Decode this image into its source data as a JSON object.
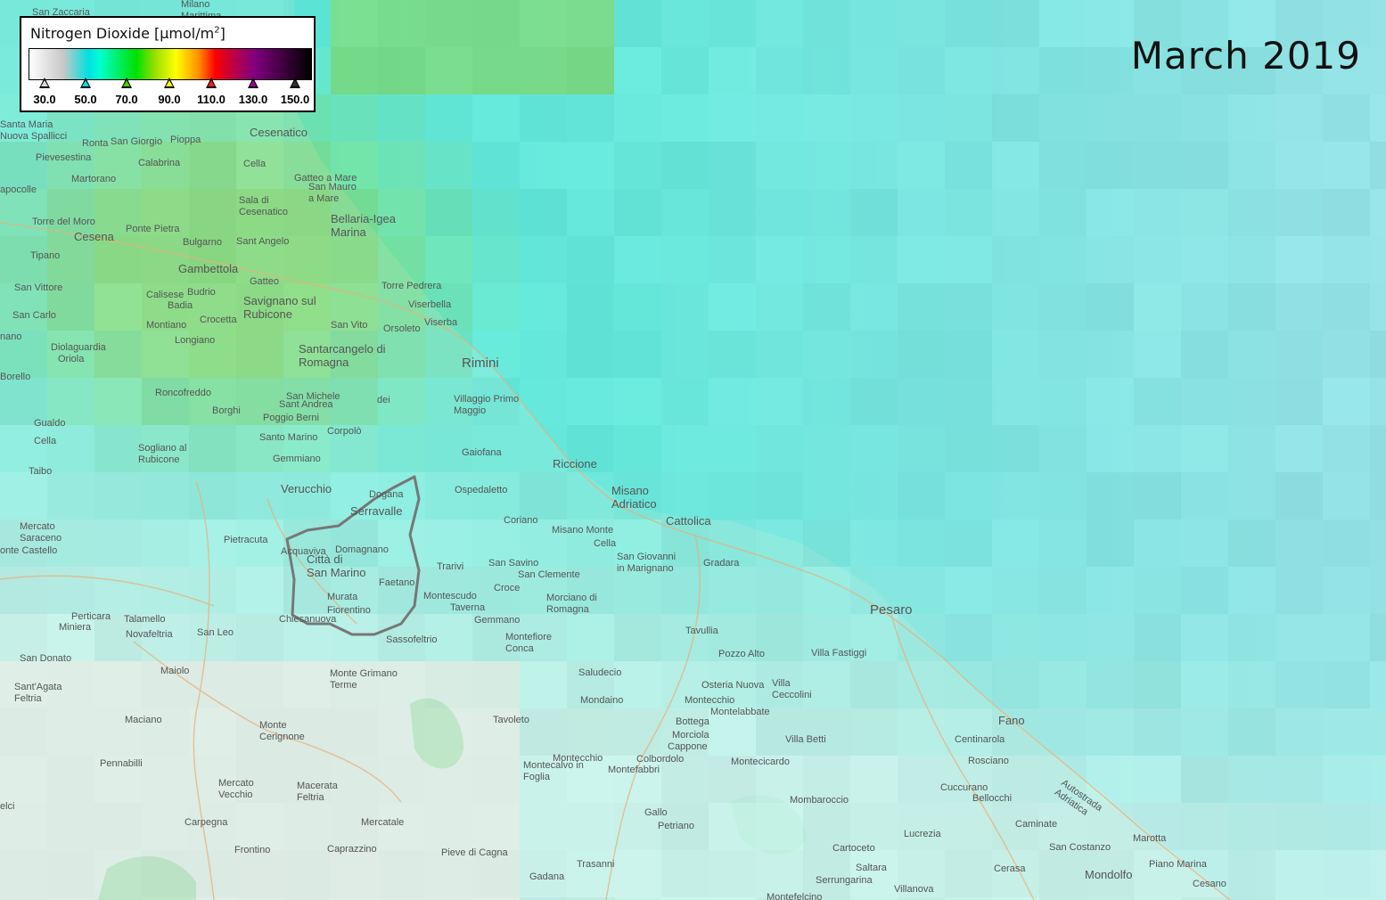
{
  "legend": {
    "title": "Nitrogen Dioxide [µmol/m",
    "title_sup": "2",
    "title_end": "]",
    "ticks": [
      {
        "label": "30.0",
        "color": "#d8d8d8"
      },
      {
        "label": "50.0",
        "color": "#00e0e0"
      },
      {
        "label": "70.0",
        "color": "#40d000"
      },
      {
        "label": "90.0",
        "color": "#ffff00"
      },
      {
        "label": "110.0",
        "color": "#ff2020"
      },
      {
        "label": "130.0",
        "color": "#a000a0"
      },
      {
        "label": "150.0",
        "color": "#303030"
      }
    ]
  },
  "date_label": "March 2019",
  "colors": {
    "sea": "#a9e2ea",
    "high_no2": "#7ad87a",
    "mid_no2": "#5de6d6",
    "low_no2": "#c7efe8",
    "land": "#eeeae3",
    "country_border": "#777777"
  },
  "places": [
    {
      "name": "Milano Marittima",
      "size": "sm"
    },
    {
      "name": "San Zaccaria",
      "size": "sm"
    },
    {
      "name": "Cesenatico",
      "size": "md"
    },
    {
      "name": "Santa Maria Nuova Spallicci",
      "size": "sm"
    },
    {
      "name": "Ronta",
      "size": "sm"
    },
    {
      "name": "San Giorgio",
      "size": "sm"
    },
    {
      "name": "Pioppa",
      "size": "sm"
    },
    {
      "name": "Pievesestina",
      "size": "sm"
    },
    {
      "name": "Calabrina",
      "size": "sm"
    },
    {
      "name": "Cella",
      "size": "sm"
    },
    {
      "name": "Martorano",
      "size": "sm"
    },
    {
      "name": "Gatteo a Mare",
      "size": "sm"
    },
    {
      "name": "San Mauro a Mare",
      "size": "sm"
    },
    {
      "name": "apocolle",
      "size": "sm"
    },
    {
      "name": "Sala di Cesenatico",
      "size": "sm"
    },
    {
      "name": "Torre del Moro",
      "size": "sm"
    },
    {
      "name": "Bellaria-Igea Marina",
      "size": "md"
    },
    {
      "name": "Cesena",
      "size": "md"
    },
    {
      "name": "Ponte Pietra",
      "size": "sm"
    },
    {
      "name": "Bulgarno",
      "size": "sm"
    },
    {
      "name": "Sant Angelo",
      "size": "sm"
    },
    {
      "name": "Tipano",
      "size": "sm"
    },
    {
      "name": "Gambettola",
      "size": "md"
    },
    {
      "name": "Gatteo",
      "size": "sm"
    },
    {
      "name": "Torre Pedrera",
      "size": "sm"
    },
    {
      "name": "San Vittore",
      "size": "sm"
    },
    {
      "name": "Calisese",
      "size": "sm"
    },
    {
      "name": "Budrio",
      "size": "sm"
    },
    {
      "name": "Badia",
      "size": "sm"
    },
    {
      "name": "Savignano sul Rubicone",
      "size": "md"
    },
    {
      "name": "Viserbella",
      "size": "sm"
    },
    {
      "name": "San Carlo",
      "size": "sm"
    },
    {
      "name": "Crocetta",
      "size": "sm"
    },
    {
      "name": "Viserba",
      "size": "sm"
    },
    {
      "name": "Montiano",
      "size": "sm"
    },
    {
      "name": "San Vito",
      "size": "sm"
    },
    {
      "name": "Orsoleto",
      "size": "sm"
    },
    {
      "name": "nano",
      "size": "sm"
    },
    {
      "name": "Longiano",
      "size": "sm"
    },
    {
      "name": "Diolaguardia",
      "size": "sm"
    },
    {
      "name": "Oriola",
      "size": "sm"
    },
    {
      "name": "Santarcangelo di Romagna",
      "size": "md"
    },
    {
      "name": "Rimini",
      "size": "lg"
    },
    {
      "name": "Borello",
      "size": "sm"
    },
    {
      "name": "Roncofreddo",
      "size": "sm"
    },
    {
      "name": "San Michele",
      "size": "sm"
    },
    {
      "name": "Sant Andrea",
      "size": "sm"
    },
    {
      "name": "dei",
      "size": "sm"
    },
    {
      "name": "Villaggio Primo Maggio",
      "size": "sm"
    },
    {
      "name": "Borghi",
      "size": "sm"
    },
    {
      "name": "Poggio Berni",
      "size": "sm"
    },
    {
      "name": "Gualdo",
      "size": "sm"
    },
    {
      "name": "Corpolò",
      "size": "sm"
    },
    {
      "name": "Cella",
      "size": "sm"
    },
    {
      "name": "Santo Marino",
      "size": "sm"
    },
    {
      "name": "Sogliano al Rubicone",
      "size": "sm"
    },
    {
      "name": "Gaiofana",
      "size": "sm"
    },
    {
      "name": "Gemmiano",
      "size": "sm"
    },
    {
      "name": "Riccione",
      "size": "md"
    },
    {
      "name": "Taibo",
      "size": "sm"
    },
    {
      "name": "Verucchio",
      "size": "md"
    },
    {
      "name": "Dogana",
      "size": "sm"
    },
    {
      "name": "Ospedaletto",
      "size": "sm"
    },
    {
      "name": "Misano Adriatico",
      "size": "md"
    },
    {
      "name": "Serravalle",
      "size": "md"
    },
    {
      "name": "Coriano",
      "size": "sm"
    },
    {
      "name": "Cattolica",
      "size": "md"
    },
    {
      "name": "Mercato Saraceno",
      "size": "sm"
    },
    {
      "name": "Pietracuta",
      "size": "sm"
    },
    {
      "name": "Misano Monte",
      "size": "sm"
    },
    {
      "name": "Cella",
      "size": "sm"
    },
    {
      "name": "onte Castello",
      "size": "sm"
    },
    {
      "name": "Acquaviva",
      "size": "sm"
    },
    {
      "name": "Domagnano",
      "size": "sm"
    },
    {
      "name": "San Giovanni in Marignano",
      "size": "sm"
    },
    {
      "name": "Città di San Marino",
      "size": "md"
    },
    {
      "name": "Trarivi",
      "size": "sm"
    },
    {
      "name": "San Savino",
      "size": "sm"
    },
    {
      "name": "Gradara",
      "size": "sm"
    },
    {
      "name": "San Clemente",
      "size": "sm"
    },
    {
      "name": "Faetano",
      "size": "sm"
    },
    {
      "name": "Croce",
      "size": "sm"
    },
    {
      "name": "Pesaro",
      "size": "lg"
    },
    {
      "name": "Montescudo",
      "size": "sm"
    },
    {
      "name": "Morciano di Romagna",
      "size": "sm"
    },
    {
      "name": "Murata",
      "size": "sm"
    },
    {
      "name": "Taverna",
      "size": "sm"
    },
    {
      "name": "Fiorentino",
      "size": "sm"
    },
    {
      "name": "Perticara",
      "size": "sm"
    },
    {
      "name": "Talamello",
      "size": "sm"
    },
    {
      "name": "Chiesanuova",
      "size": "sm"
    },
    {
      "name": "Gemmano",
      "size": "sm"
    },
    {
      "name": "Miniera",
      "size": "sm"
    },
    {
      "name": "Novafeltria",
      "size": "sm"
    },
    {
      "name": "San Leo",
      "size": "sm"
    },
    {
      "name": "Tavullia",
      "size": "sm"
    },
    {
      "name": "Sassofeltrio",
      "size": "sm"
    },
    {
      "name": "Montefiore Conca",
      "size": "sm"
    },
    {
      "name": "Pozzo Alto",
      "size": "sm"
    },
    {
      "name": "Villa Fastiggi",
      "size": "sm"
    },
    {
      "name": "San Donato",
      "size": "sm"
    },
    {
      "name": "Maiolo",
      "size": "sm"
    },
    {
      "name": "Monte Grimano Terme",
      "size": "sm"
    },
    {
      "name": "Saludecio",
      "size": "sm"
    },
    {
      "name": "Osteria Nuova",
      "size": "sm"
    },
    {
      "name": "Villa Ceccolini",
      "size": "sm"
    },
    {
      "name": "Sant'Agata Feltria",
      "size": "sm"
    },
    {
      "name": "Mondaino",
      "size": "sm"
    },
    {
      "name": "Montecchio",
      "size": "sm"
    },
    {
      "name": "Montelabbate",
      "size": "sm"
    },
    {
      "name": "Maciano",
      "size": "sm"
    },
    {
      "name": "Tavoleto",
      "size": "sm"
    },
    {
      "name": "Bottega",
      "size": "sm"
    },
    {
      "name": "Fano",
      "size": "md"
    },
    {
      "name": "Monte Cerignone",
      "size": "sm"
    },
    {
      "name": "Morciola",
      "size": "sm"
    },
    {
      "name": "Villa Betti",
      "size": "sm"
    },
    {
      "name": "Centinarola",
      "size": "sm"
    },
    {
      "name": "Cappone",
      "size": "sm"
    },
    {
      "name": "Colbordolo",
      "size": "sm"
    },
    {
      "name": "Montecchio",
      "size": "sm"
    },
    {
      "name": "Rosciano",
      "size": "sm"
    },
    {
      "name": "Pennabilli",
      "size": "sm"
    },
    {
      "name": "Montecalvo in Foglia",
      "size": "sm"
    },
    {
      "name": "Montefabbri",
      "size": "sm"
    },
    {
      "name": "Montecicardo",
      "size": "sm"
    },
    {
      "name": "Mercato Vecchio",
      "size": "sm"
    },
    {
      "name": "Macerata Feltria",
      "size": "sm"
    },
    {
      "name": "Cuccurano",
      "size": "sm"
    },
    {
      "name": "Bellocchi",
      "size": "sm"
    },
    {
      "name": "Autostrada Adriatica",
      "size": "sm"
    },
    {
      "name": "Mombaroccio",
      "size": "sm"
    },
    {
      "name": "elci",
      "size": "sm"
    },
    {
      "name": "Gallo",
      "size": "sm"
    },
    {
      "name": "Carpegna",
      "size": "sm"
    },
    {
      "name": "Mercatale",
      "size": "sm"
    },
    {
      "name": "Caminate",
      "size": "sm"
    },
    {
      "name": "Petriano",
      "size": "sm"
    },
    {
      "name": "Lucrezia",
      "size": "sm"
    },
    {
      "name": "Marotta",
      "size": "sm"
    },
    {
      "name": "Frontino",
      "size": "sm"
    },
    {
      "name": "Caprazzino",
      "size": "sm"
    },
    {
      "name": "Pieve di Cagna",
      "size": "sm"
    },
    {
      "name": "Cartoceto",
      "size": "sm"
    },
    {
      "name": "San Costanzo",
      "size": "sm"
    },
    {
      "name": "Trasanni",
      "size": "sm"
    },
    {
      "name": "Saltara",
      "size": "sm"
    },
    {
      "name": "Cerasa",
      "size": "sm"
    },
    {
      "name": "Piano Marina",
      "size": "sm"
    },
    {
      "name": "Gadana",
      "size": "sm"
    },
    {
      "name": "Serrungarina",
      "size": "sm"
    },
    {
      "name": "Mondolfo",
      "size": "md"
    },
    {
      "name": "Cesano",
      "size": "sm"
    },
    {
      "name": "Villanova",
      "size": "sm"
    },
    {
      "name": "Montefelcino",
      "size": "sm"
    }
  ]
}
